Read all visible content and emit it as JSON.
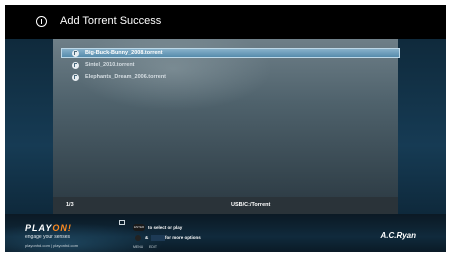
{
  "header": {
    "title": "Add Torrent Success",
    "icon": "info-icon"
  },
  "files": [
    {
      "name": "Big-Buck-Bunny_2008.torrent",
      "selected": true
    },
    {
      "name": "Sintel_2010.torrent",
      "selected": false
    },
    {
      "name": "Elephants_Dream_2006.torrent",
      "selected": false
    }
  ],
  "status": {
    "page": "1/3",
    "path": "USB/C:/Torrent"
  },
  "footer": {
    "brand_main": "PLAY",
    "brand_accent": "ON!",
    "tagline": "engage your senses",
    "site": "playonhd.com | playonhd.com",
    "enter_label": "ENTER",
    "hint_select": "to select or play",
    "hint_prefix": "&",
    "hint_options": "for more options",
    "menu_label": "MENU",
    "edit_label": "EDIT",
    "maker_logo": "A.C.Ryan"
  },
  "colors": {
    "selection": "#4f87a8",
    "brand_accent": "#ff8a1f"
  }
}
